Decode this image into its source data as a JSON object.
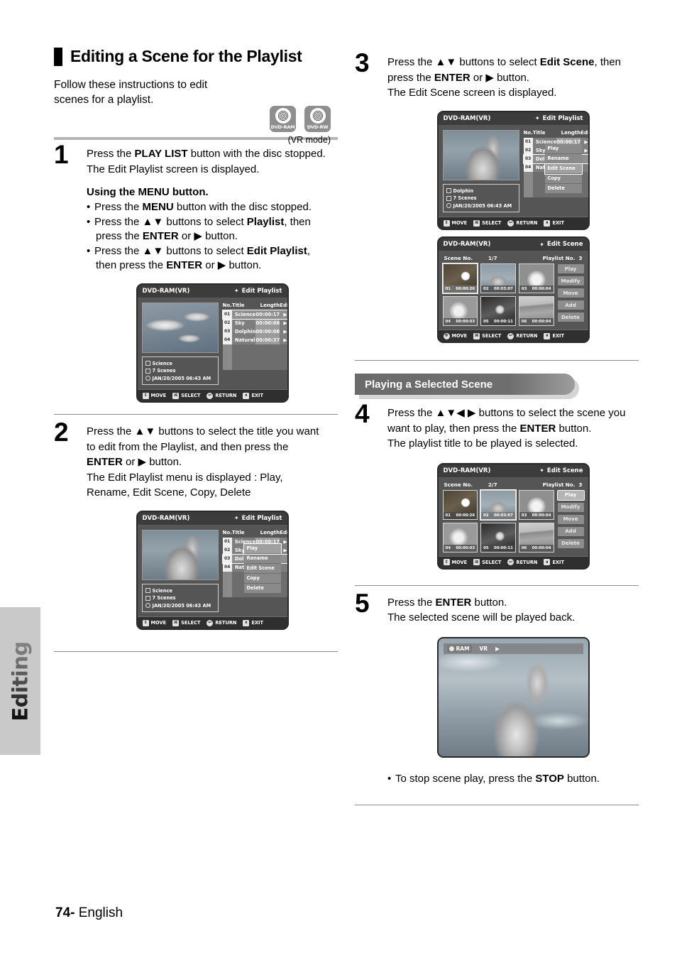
{
  "sidebar": {
    "tab_label": "Editing"
  },
  "footer": {
    "page": "74",
    "dash": "-",
    "language": "English"
  },
  "section": {
    "title": "Editing a Scene for the Playlist",
    "intro": "Follow these instructions to edit scenes for a playlist.",
    "vr_mode": "(VR mode)",
    "logos": [
      {
        "name": "DVD-RAM"
      },
      {
        "name": "DVD-RW"
      }
    ]
  },
  "steps": {
    "s1": {
      "num": "1",
      "line1_a": "Press the ",
      "line1_b": "PLAY LIST",
      "line1_c": " button with the disc stopped.",
      "line2": "The Edit Playlist screen is displayed.",
      "sub_head": "Using the MENU button.",
      "b1_a": "Press the ",
      "b1_b": "MENU",
      "b1_c": " button with the disc stopped.",
      "b2_a": "Press the ▲▼ buttons to select ",
      "b2_b": "Playlist",
      "b2_c": ", then",
      "b2_d": "press the ",
      "b2_e": "ENTER",
      "b2_f": " or ▶ button.",
      "b3_a": "Press the ▲▼ buttons to select ",
      "b3_b": "Edit Playlist",
      "b3_c": ",",
      "b3_d": "then press the ",
      "b3_e": "ENTER",
      "b3_f": " or ▶ button."
    },
    "s2": {
      "num": "2",
      "line1": "Press the ▲▼ buttons to select the title you want",
      "line2": "to edit from the Playlist, and then press the",
      "line3_a": "ENTER",
      "line3_b": " or ▶ button.",
      "line4": "The Edit Playlist menu is displayed : Play,",
      "line5": "Rename, Edit Scene, Copy, Delete"
    },
    "s3": {
      "num": "3",
      "line1_a": "Press the  ▲▼ buttons to select ",
      "line1_b": "Edit Scene",
      "line1_c": ", then",
      "line2_a": "press the ",
      "line2_b": "ENTER",
      "line2_c": " or ▶ button.",
      "line3": "The Edit Scene screen is displayed."
    },
    "s4": {
      "num": "4",
      "line1": "Press the ▲▼◀ ▶ buttons to select the scene you",
      "line2_a": "want to play, then press the ",
      "line2_b": "ENTER",
      "line2_c": " button.",
      "line3": "The playlist title to be played is selected."
    },
    "s5": {
      "num": "5",
      "line1_a": "Press the ",
      "line1_b": "ENTER",
      "line1_c": " button.",
      "line2": "The selected scene will be played back.",
      "note_a": "To stop scene play, press the ",
      "note_b": "STOP",
      "note_c": " button."
    }
  },
  "banner": {
    "label": "Playing a Selected Scene"
  },
  "screens": {
    "bottom_bar": [
      {
        "icon": "updown-arrows-icon",
        "glyph": "↕",
        "label": "MOVE"
      },
      {
        "icon": "enter-button-icon",
        "glyph": "⌘",
        "label": "SELECT"
      },
      {
        "icon": "return-arrow-icon",
        "glyph": "↩",
        "label": "RETURN"
      },
      {
        "icon": "exit-icon",
        "glyph": "⏸",
        "label": "EXIT"
      }
    ],
    "bottom_bar_4way": [
      {
        "icon": "fourway-arrows-icon",
        "glyph": "✥",
        "label": "MOVE"
      },
      {
        "icon": "enter-button-icon",
        "glyph": "⌘",
        "label": "SELECT"
      },
      {
        "icon": "return-arrow-icon",
        "glyph": "↩",
        "label": "RETURN"
      },
      {
        "icon": "exit-icon",
        "glyph": "⏸",
        "label": "EXIT"
      }
    ],
    "playlist_columns": {
      "no": "No.",
      "title": "Title",
      "length": "Length",
      "edit": "Edit"
    },
    "playlist_rows": [
      {
        "no": "01",
        "title": "Science",
        "length": "00:00:17",
        "edit": "▶"
      },
      {
        "no": "02",
        "title": "Sky",
        "length": "00:00:06",
        "edit": "▶"
      },
      {
        "no": "03",
        "title": "Dolphin",
        "length": "00:00:06",
        "edit": "▶"
      },
      {
        "no": "04",
        "title": "Natural",
        "length": "00:00:37",
        "edit": "▶"
      }
    ],
    "edit_menu": [
      "Play",
      "Rename",
      "Edit Scene",
      "Copy",
      "Delete"
    ],
    "screen1": {
      "disc_label": "DVD-RAM(VR)",
      "mode_label": "Edit Playlist",
      "info_title": "Science",
      "info_scenes": "7 Scenes",
      "info_date": "JAN/20/2005 06:43 AM",
      "selected_row": "01",
      "thumb": "seagulls-thumbnail"
    },
    "screen2": {
      "disc_label": "DVD-RAM(VR)",
      "mode_label": "Edit Playlist",
      "info_title": "Science",
      "info_scenes": "7 Scenes",
      "info_date": "JAN/20/2005 06:43 AM",
      "selected_row": "03",
      "selected_menu": "Play",
      "thumb": "dolphin-thumbnail"
    },
    "screen3": {
      "disc_label": "DVD-RAM(VR)",
      "mode_label": "Edit Playlist",
      "info_title": "Dolphin",
      "info_scenes": "7 Scenes",
      "info_date": "JAN/20/2005 06:43 AM",
      "selected_row": "03",
      "selected_menu": "Edit Scene",
      "thumb": "dolphin-thumbnail"
    },
    "screen4": {
      "disc_label": "DVD-RAM(VR)",
      "mode_label": "Edit Scene",
      "scene_no_label": "Scene No.",
      "scene_no_value": "1/7",
      "playlist_no_label": "Playlist No.",
      "playlist_no_value": "3",
      "selected_scene": "01",
      "selected_button": "",
      "scenes": [
        {
          "no": "01",
          "time": "00:00:26"
        },
        {
          "no": "02",
          "time": "00:03:07"
        },
        {
          "no": "03",
          "time": "00:00:04"
        },
        {
          "no": "04",
          "time": "00:00:03"
        },
        {
          "no": "05",
          "time": "00:00:11"
        },
        {
          "no": "06",
          "time": "00:00:04"
        }
      ],
      "buttons": [
        "Play",
        "Modify",
        "Move",
        "Add",
        "Delete"
      ]
    },
    "screen5": {
      "disc_label": "DVD-RAM(VR)",
      "mode_label": "Edit Scene",
      "scene_no_label": "Scene No.",
      "scene_no_value": "2/7",
      "playlist_no_label": "Playlist No.",
      "playlist_no_value": "3",
      "selected_scene": "02",
      "selected_button": "Play",
      "scenes": [
        {
          "no": "01",
          "time": "00:00:26"
        },
        {
          "no": "02",
          "time": "00:03:07"
        },
        {
          "no": "03",
          "time": "00:00:04"
        },
        {
          "no": "04",
          "time": "00:00:03"
        },
        {
          "no": "05",
          "time": "00:00:11"
        },
        {
          "no": "06",
          "time": "00:00:04"
        }
      ],
      "buttons": [
        "Play",
        "Modify",
        "Move",
        "Add",
        "Delete"
      ]
    },
    "playback": {
      "disc_badge": "RAM",
      "mode_badge": "VR",
      "play_glyph": "▶"
    }
  }
}
